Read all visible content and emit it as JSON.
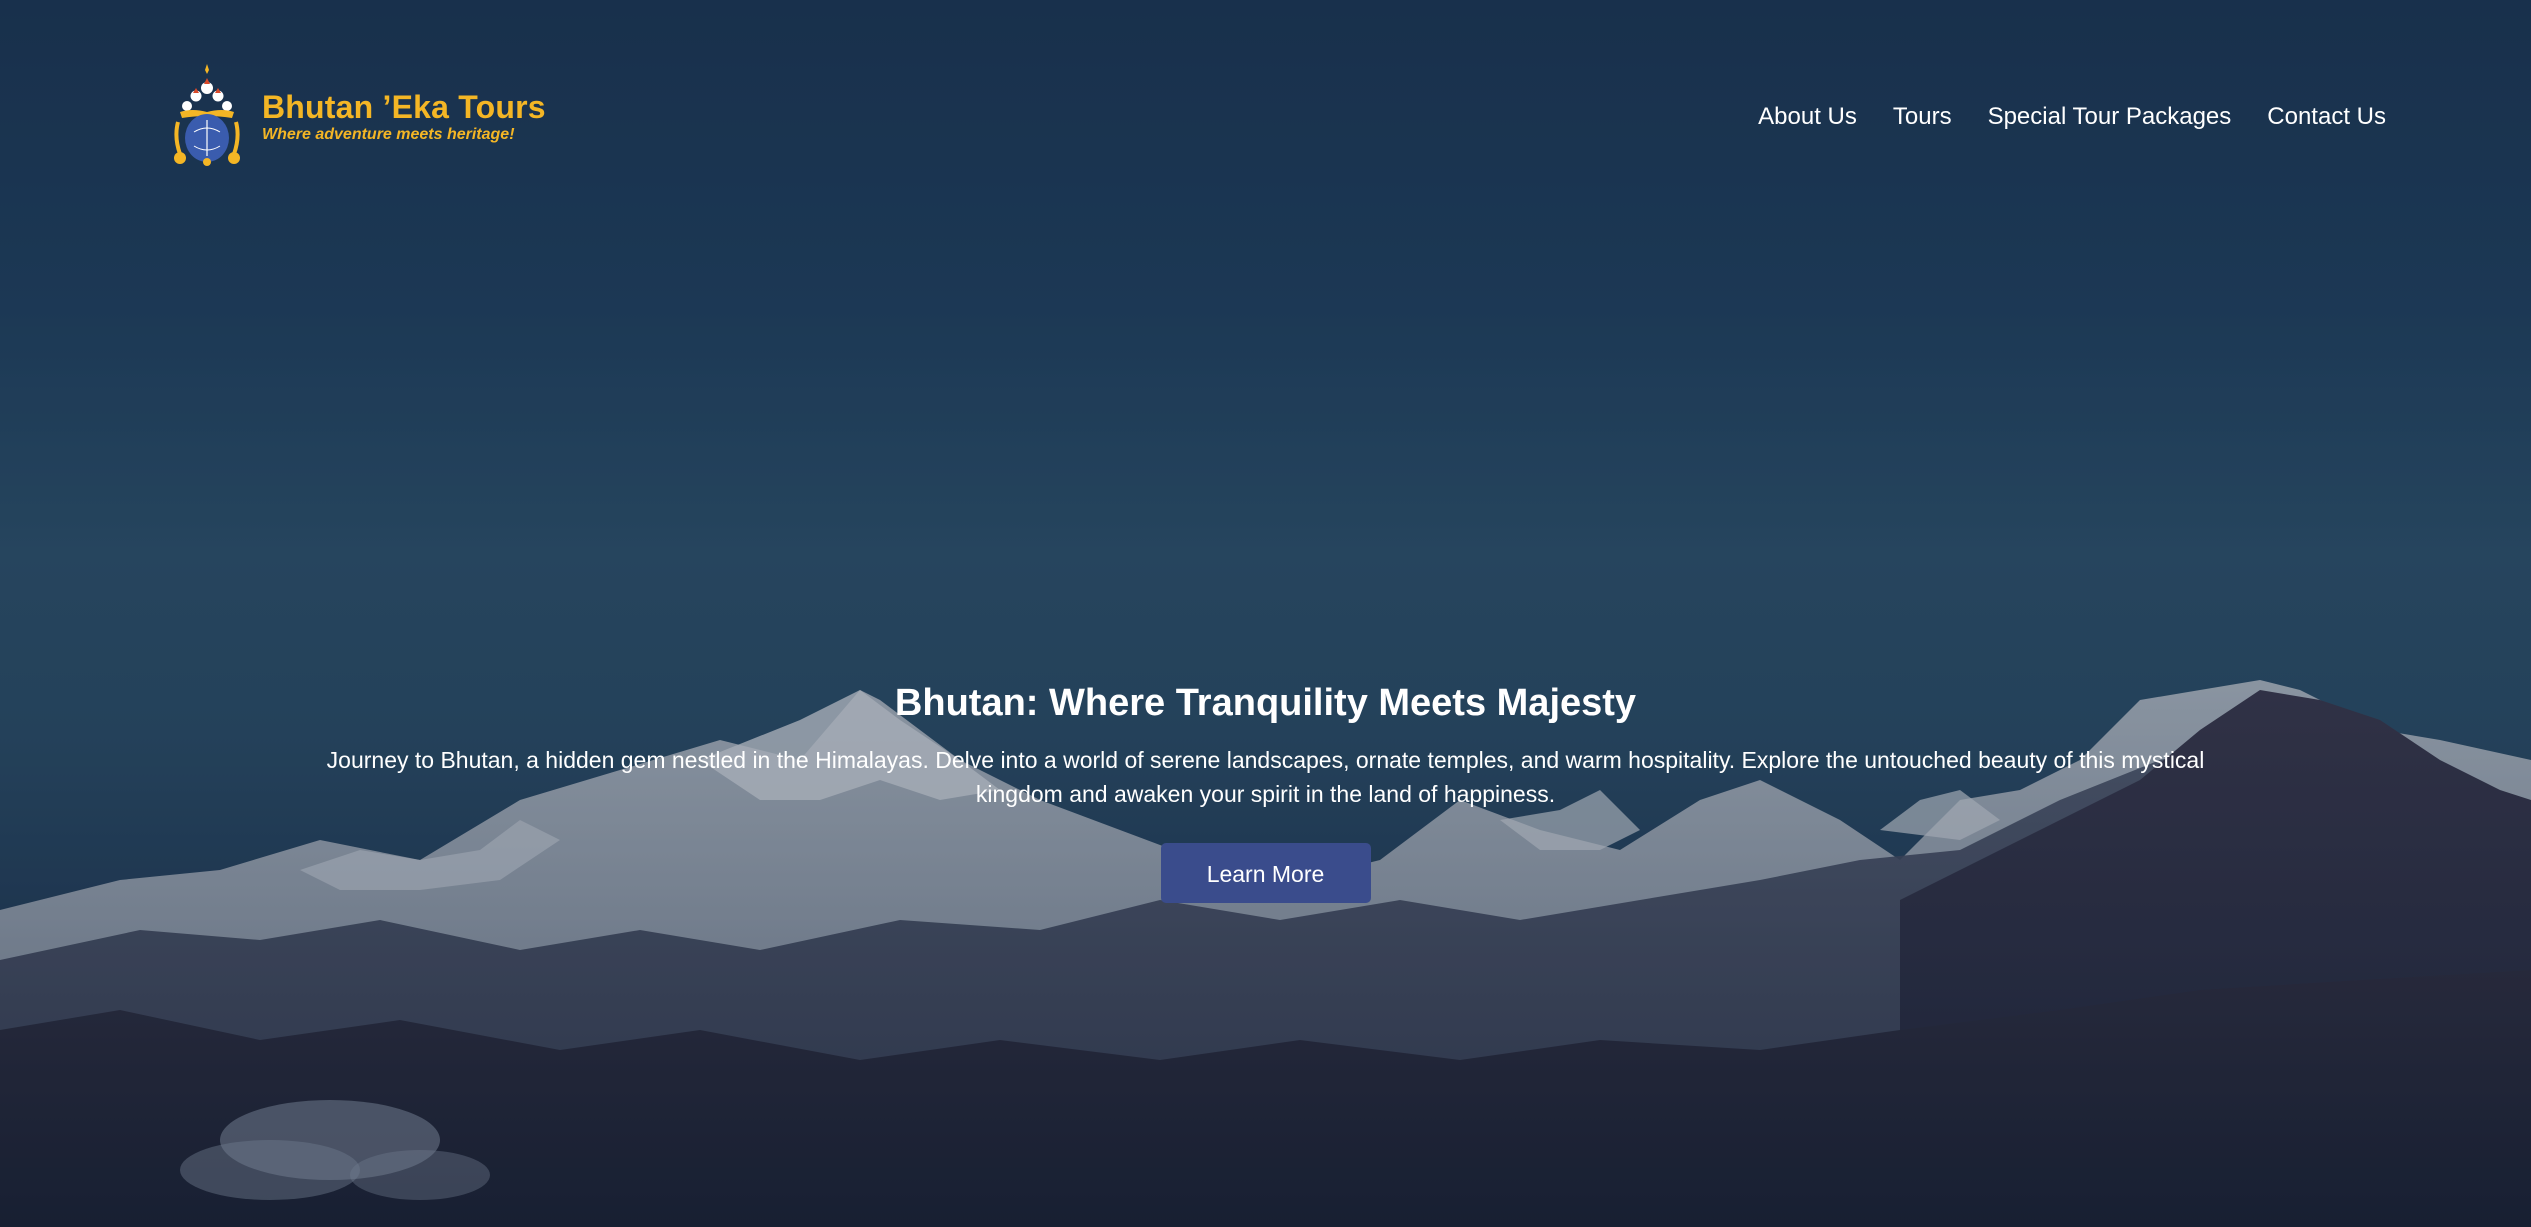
{
  "brand": {
    "name": "Bhutan ’Eka Tours",
    "tagline": "Where adventure meets heritage!",
    "logo_icon": "bhutan-emblem-icon",
    "color": "#f4b625"
  },
  "nav": {
    "items": [
      {
        "label": "About Us"
      },
      {
        "label": "Tours"
      },
      {
        "label": "Special Tour Packages"
      },
      {
        "label": "Contact Us"
      }
    ]
  },
  "hero": {
    "title": "Bhutan: Where Tranquility Meets Majesty",
    "description": "Journey to Bhutan, a hidden gem nestled in the Himalayas. Delve into a world of serene landscapes, ornate temples, and warm hospitality. Explore the untouched beauty of this mystical kingdom and awaken your spirit in the land of happiness.",
    "cta_label": "Learn More",
    "cta_color": "#3a4c8c",
    "background": "himalayan-mountains-image"
  }
}
